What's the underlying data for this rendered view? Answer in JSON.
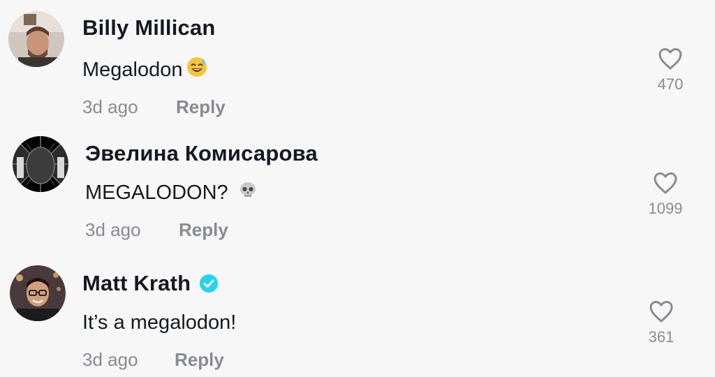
{
  "comments": [
    {
      "username": "Billy Millican",
      "text": "Megalodon",
      "emoji": "sweat-smile-emoji",
      "time": "3d ago",
      "reply_label": "Reply",
      "likes": "470",
      "verified": false
    },
    {
      "username": "Эвелина Комисарова",
      "text": "MEGALODON?",
      "emoji": "skull-emoji",
      "time": "3d ago",
      "reply_label": "Reply",
      "likes": "1099",
      "verified": false
    },
    {
      "username": "Matt Krath",
      "text": "It’s a megalodon!",
      "emoji": "",
      "time": "3d ago",
      "reply_label": "Reply",
      "likes": "361",
      "verified": true
    }
  ],
  "colors": {
    "background": "#f7f7f7",
    "text_primary": "#161823",
    "text_secondary": "#8a8b91",
    "verified_badge": "#20d5ec"
  }
}
